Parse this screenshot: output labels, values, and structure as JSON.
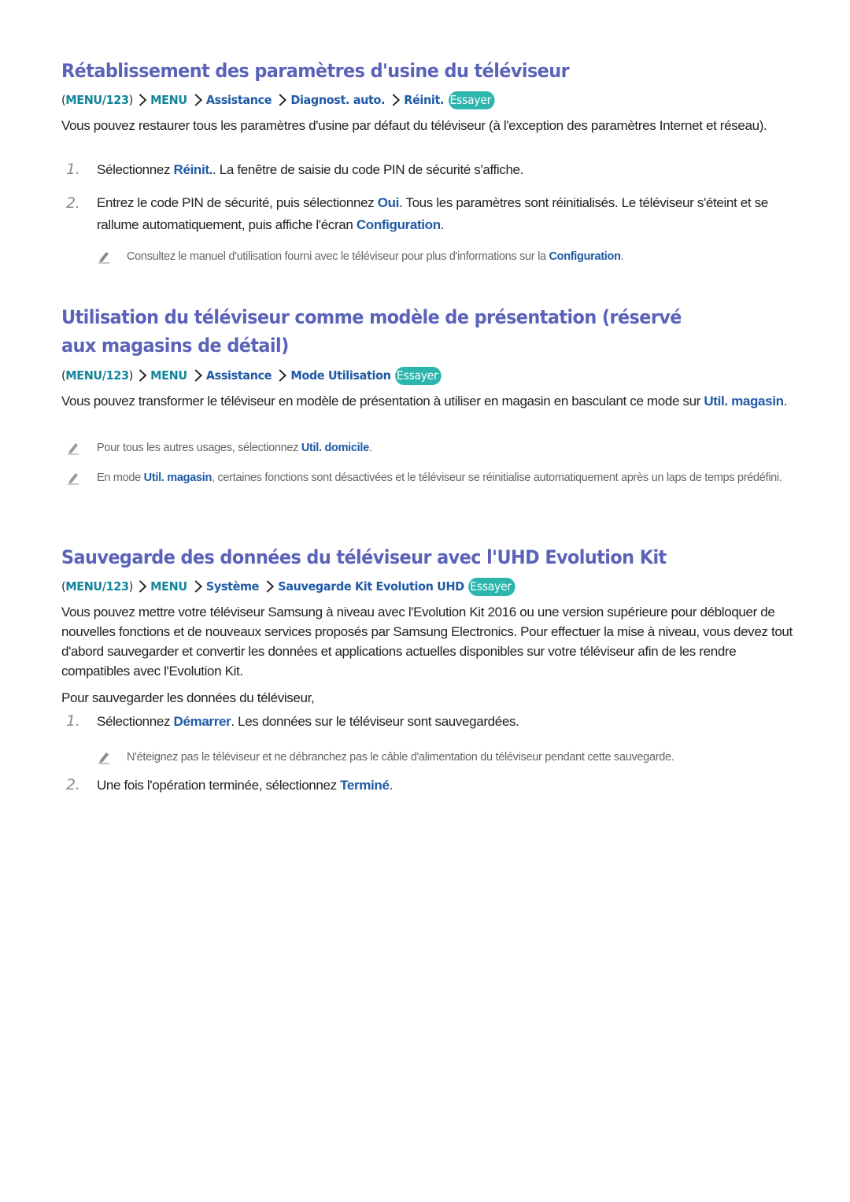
{
  "sections": [
    {
      "title": "Rétablissement des paramètres d'usine du téléviseur",
      "path": {
        "open": "(",
        "root": "MENU/123",
        "close": ")",
        "items": [
          "MENU",
          "Assistance",
          "Diagnost. auto.",
          "Réinit."
        ],
        "badge": "Essayer"
      },
      "intro": "Vous pouvez restaurer tous les paramètres d'usine par défaut du téléviseur (à l'exception des paramètres Internet et réseau).",
      "steps": [
        {
          "num": "1.",
          "pre": "Sélectionnez ",
          "kw": "Réinit.",
          "post": ". La fenêtre de saisie du code PIN de sécurité s'affiche."
        },
        {
          "num": "2.",
          "pre": "Entrez le code PIN de sécurité, puis sélectionnez ",
          "kw": "Oui",
          "mid": ". Tous les paramètres sont réinitialisés. Le téléviseur s'éteint et se rallume automatiquement, puis affiche l'écran ",
          "kw2": "Configuration",
          "post": "."
        }
      ],
      "note": {
        "pre": "Consultez le manuel d'utilisation fourni avec le téléviseur pour plus d'informations sur la ",
        "kw": "Configuration",
        "post": "."
      }
    },
    {
      "title": "Utilisation du téléviseur comme modèle de présentation (réservé aux magasins de détail)",
      "path": {
        "open": "(",
        "root": "MENU/123",
        "close": ")",
        "items": [
          "MENU",
          "Assistance",
          "Mode Utilisation"
        ],
        "badge": "Essayer"
      },
      "intro": {
        "pre": "Vous pouvez transformer le téléviseur en modèle de présentation à utiliser en magasin en basculant ce mode sur ",
        "kw": "Util. magasin",
        "post": "."
      },
      "notes": [
        {
          "pre": "Pour tous les autres usages, sélectionnez ",
          "kw": "Util. domicile",
          "post": "."
        },
        {
          "pre": "En mode ",
          "kw": "Util. magasin",
          "post": ", certaines fonctions sont désactivées et le téléviseur se réinitialise automatiquement après un laps de temps prédéfini."
        }
      ]
    },
    {
      "title": "Sauvegarde des données du téléviseur avec l'UHD Evolution Kit",
      "path": {
        "open": "(",
        "root": "MENU/123",
        "close": ")",
        "items": [
          "MENU",
          "Système",
          "Sauvegarde Kit Evolution UHD"
        ],
        "badge": "Essayer"
      },
      "intro": "Vous pouvez mettre votre téléviseur Samsung à niveau avec l'Evolution Kit 2016 ou une version supérieure pour débloquer de nouvelles fonctions et de nouveaux services proposés par Samsung Electronics. Pour effectuer la mise à niveau, vous devez tout d'abord sauvegarder et convertir les données et applications actuelles disponibles sur votre téléviseur afin de les rendre compatibles avec l'Evolution Kit.",
      "lead": "Pour sauvegarder les données du téléviseur,",
      "steps": [
        {
          "num": "1.",
          "pre": "Sélectionnez ",
          "kw": "Démarrer",
          "post": ". Les données sur le téléviseur sont sauvegardées."
        },
        {
          "num": "2.",
          "pre": "Une fois l'opération terminée, sélectionnez ",
          "kw": "Terminé",
          "post": "."
        }
      ],
      "note": {
        "pre": "",
        "kw": "",
        "post": "N'éteignez pas le téléviseur et ne débranchez pas le câble d'alimentation du téléviseur pendant cette sauvegarde."
      }
    }
  ],
  "colors": {
    "heading": "#5a63b8",
    "keyword": "#1f5aa6",
    "menu_root": "#12859a",
    "badge": "#2bb5ad",
    "note_text": "#666666"
  }
}
